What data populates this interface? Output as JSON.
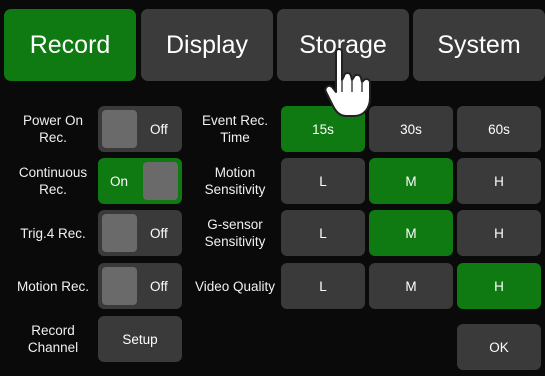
{
  "tabs": [
    {
      "label": "Record",
      "active": true
    },
    {
      "label": "Display",
      "active": false
    },
    {
      "label": "Storage",
      "active": false
    },
    {
      "label": "System",
      "active": false
    }
  ],
  "left": [
    {
      "label": "Power On Rec.",
      "state": "Off"
    },
    {
      "label": "Continuous Rec.",
      "state": "On"
    },
    {
      "label": "Trig.4 Rec.",
      "state": "Off"
    },
    {
      "label": "Motion Rec.",
      "state": "Off"
    },
    {
      "label": "Record Channel",
      "button": "Setup"
    }
  ],
  "right": [
    {
      "label": "Event Rec. Time",
      "options": [
        "15s",
        "30s",
        "60s"
      ],
      "selected": "15s"
    },
    {
      "label": "Motion Sensitivity",
      "options": [
        "L",
        "M",
        "H"
      ],
      "selected": "M"
    },
    {
      "label": "G-sensor Sensitivity",
      "options": [
        "L",
        "M",
        "H"
      ],
      "selected": "M"
    },
    {
      "label": "Video Quality",
      "options": [
        "L",
        "M",
        "H"
      ],
      "selected": "H"
    }
  ],
  "ok_label": "OK",
  "colors": {
    "selected": "#0f7a12",
    "button": "#3a3a3a",
    "background": "#0a0a0a"
  },
  "cursor_icon": "pointing-hand-icon"
}
